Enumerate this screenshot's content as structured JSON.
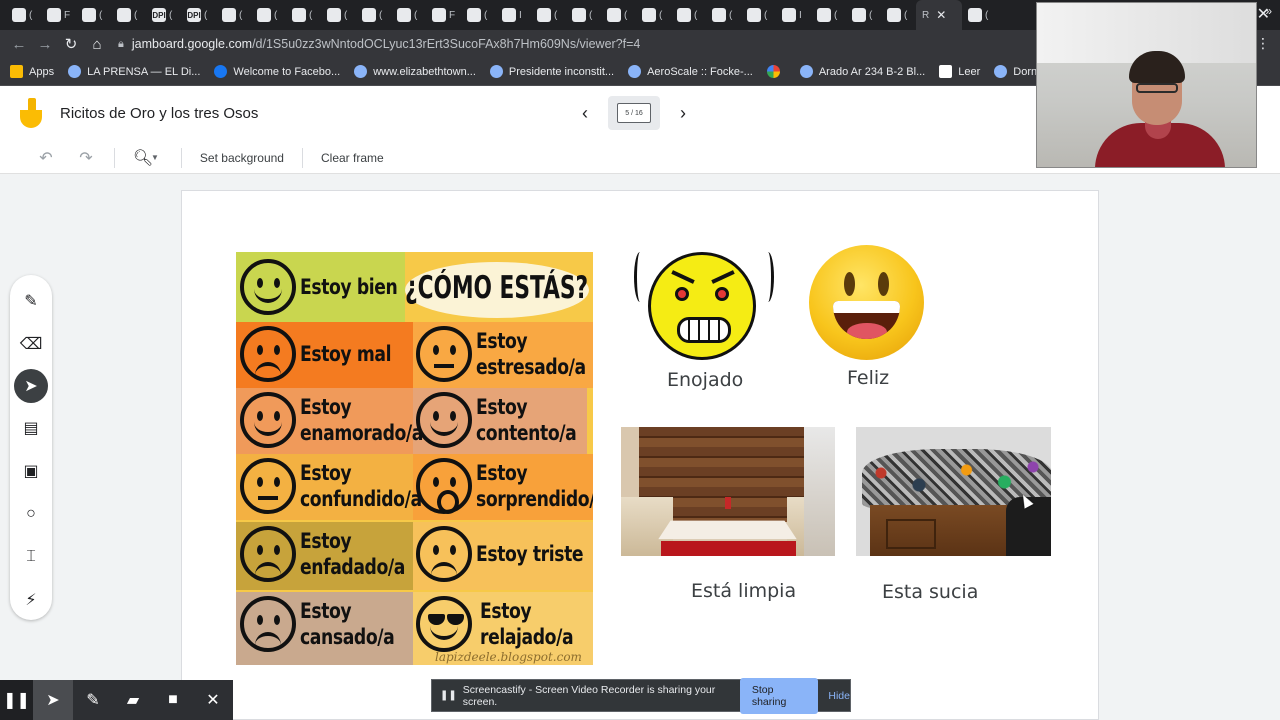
{
  "browser": {
    "tabs": [
      {
        "letter": "",
        "label": "("
      },
      {
        "letter": "",
        "label": "F"
      },
      {
        "letter": "",
        "label": "("
      },
      {
        "letter": "",
        "label": "("
      },
      {
        "letter": "DPI",
        "label": "("
      },
      {
        "letter": "DPI",
        "label": "("
      },
      {
        "letter": "",
        "label": "("
      },
      {
        "letter": "",
        "label": "("
      },
      {
        "letter": "",
        "label": "("
      },
      {
        "letter": "",
        "label": "("
      },
      {
        "letter": "",
        "label": "("
      },
      {
        "letter": "",
        "label": "("
      },
      {
        "letter": "",
        "label": "F"
      },
      {
        "letter": "",
        "label": "("
      },
      {
        "letter": "",
        "label": "I"
      },
      {
        "letter": "",
        "label": "("
      },
      {
        "letter": "",
        "label": "("
      },
      {
        "letter": "",
        "label": "("
      },
      {
        "letter": "",
        "label": "("
      },
      {
        "letter": "",
        "label": "("
      },
      {
        "letter": "",
        "label": "("
      },
      {
        "letter": "",
        "label": "("
      },
      {
        "letter": "",
        "label": "I"
      },
      {
        "letter": "",
        "label": "("
      },
      {
        "letter": "",
        "label": "("
      },
      {
        "letter": "",
        "label": "("
      },
      {
        "letter": "",
        "label": "("
      }
    ],
    "active_tab": {
      "label": "R"
    },
    "url_host": "jamboard.google.com",
    "url_path": "/d/1S5u0zz3wNntodOCLyuc13rErt3SucoFAx8h7Hm609Ns/viewer?f=4",
    "bookmarks": [
      {
        "label": "Apps",
        "icon": "apps-grid-icon"
      },
      {
        "label": "LA PRENSA — EL Di...",
        "icon": "prensa-icon"
      },
      {
        "label": "Welcome to Facebo...",
        "icon": "facebook-icon"
      },
      {
        "label": "www.elizabethtown...",
        "icon": "site-icon"
      },
      {
        "label": "Presidente inconstit...",
        "icon": "site-icon"
      },
      {
        "label": "AeroScale :: Focke-...",
        "icon": "aeroscale-icon"
      },
      {
        "label": "",
        "icon": "google-icon"
      },
      {
        "label": "Arado Ar 234 B-2 Bl...",
        "icon": "globe-icon"
      },
      {
        "label": "Leer",
        "icon": "w-icon"
      },
      {
        "label": "Dornier Do 335 A-1...",
        "icon": "globe-icon"
      }
    ]
  },
  "jamboard": {
    "title": "Ricitos de Oro y los tres Osos",
    "frame_indicator": "5 / 16",
    "toolbar": {
      "set_background": "Set background",
      "clear_frame": "Clear frame"
    }
  },
  "canvas": {
    "chart_heading": "¿CÓMO ESTÁS?",
    "chart_cells": [
      {
        "line1": "Estoy bien",
        "line2": ""
      },
      {
        "line1": "Estoy mal",
        "line2": ""
      },
      {
        "line1": "Estoy",
        "line2": "estresado/a"
      },
      {
        "line1": "Estoy",
        "line2": "enamorado/a"
      },
      {
        "line1": "Estoy",
        "line2": "contento/a"
      },
      {
        "line1": "Estoy",
        "line2": "confundido/a"
      },
      {
        "line1": "Estoy",
        "line2": "sorprendido/a"
      },
      {
        "line1": "Estoy",
        "line2": "enfadado/a"
      },
      {
        "line1": "Estoy triste",
        "line2": ""
      },
      {
        "line1": "Estoy",
        "line2": "cansado/a"
      },
      {
        "line1": "Estoy",
        "line2": "relajado/a"
      }
    ],
    "chart_watermark": "lapizdeele.blogspot.com",
    "label_angry": "Enojado",
    "label_happy": "Feliz",
    "label_clean": "Está limpia",
    "label_dirty": "Esta sucia"
  },
  "sharing": {
    "message": "Screencastify - Screen Video Recorder is sharing your screen.",
    "stop": "Stop sharing",
    "hide": "Hide"
  }
}
